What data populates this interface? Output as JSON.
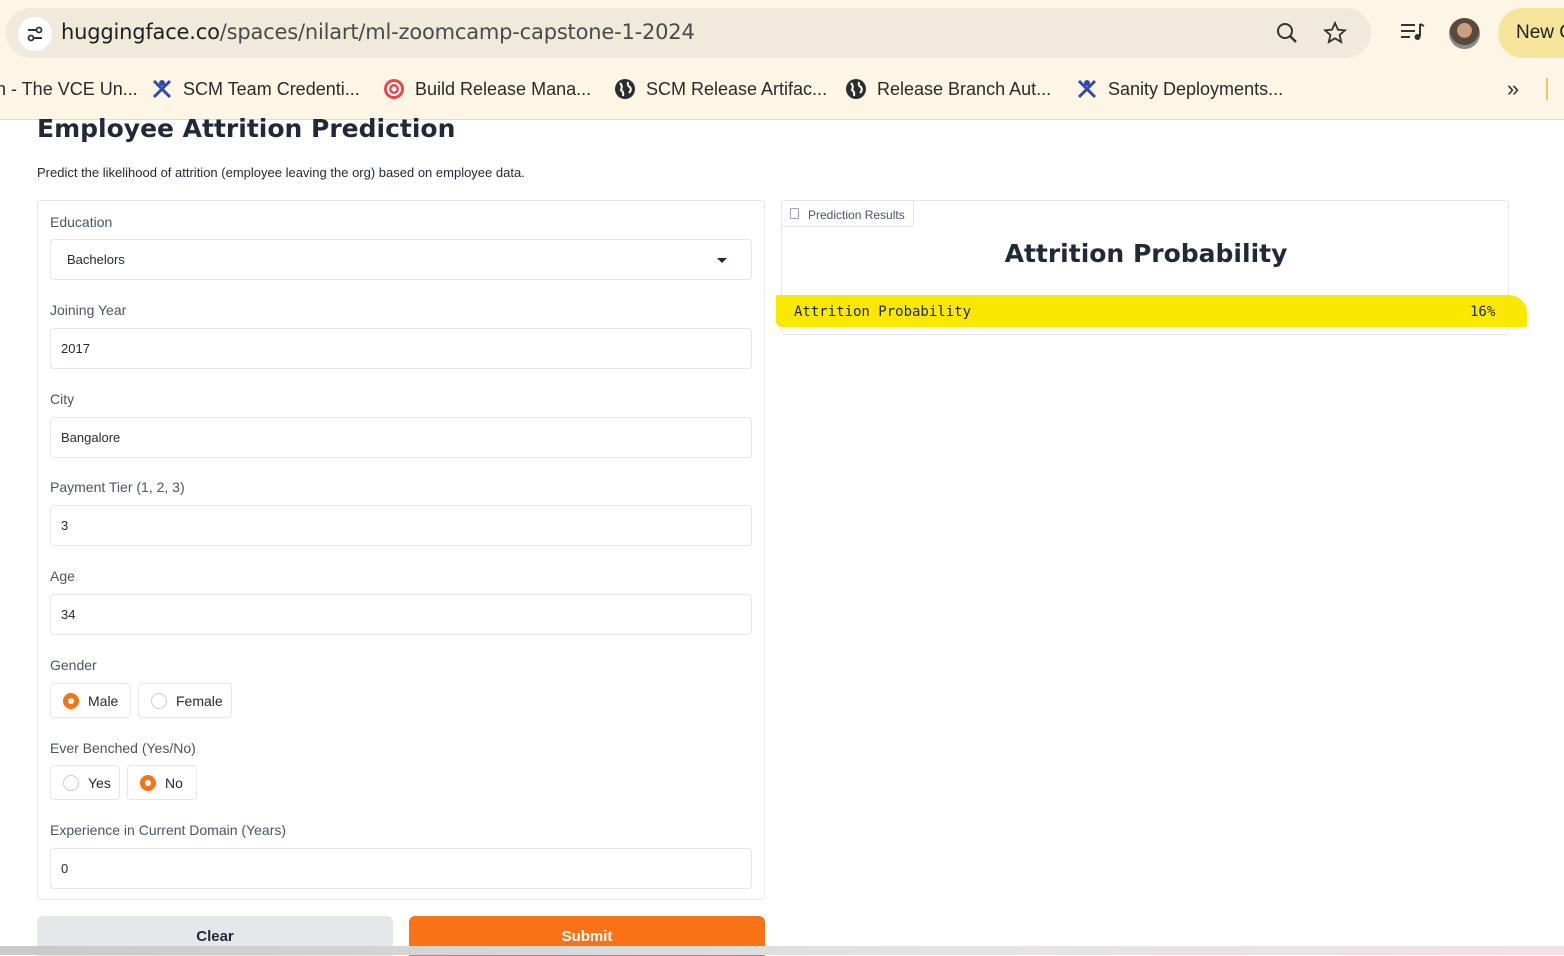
{
  "browser": {
    "url_host": "huggingface.co",
    "url_path": "/spaces/nilart/ml-zoomcamp-capstone-1-2024",
    "new_chip_label": "New C",
    "bookmarks": [
      {
        "label": "n - The VCE Un...",
        "icon": "none"
      },
      {
        "label": "SCM Team Credenti...",
        "icon": "team-icon"
      },
      {
        "label": "Build Release Mana...",
        "icon": "build-icon"
      },
      {
        "label": "SCM Release Artifac...",
        "icon": "globe-icon"
      },
      {
        "label": "Release Branch Aut...",
        "icon": "globe-icon"
      },
      {
        "label": "Sanity Deployments...",
        "icon": "team-icon"
      }
    ],
    "more_label": "»"
  },
  "page": {
    "title": "Employee Attrition Prediction",
    "description": "Predict the likelihood of attrition (employee leaving the org) based on employee data."
  },
  "form": {
    "education": {
      "label": "Education",
      "value": "Bachelors"
    },
    "joining_year": {
      "label": "Joining Year",
      "value": "2017"
    },
    "city": {
      "label": "City",
      "value": "Bangalore"
    },
    "payment_tier": {
      "label": "Payment Tier (1, 2, 3)",
      "value": "3"
    },
    "age": {
      "label": "Age",
      "value": "34"
    },
    "gender": {
      "label": "Gender",
      "options": [
        "Male",
        "Female"
      ],
      "selected": "Male"
    },
    "ever_benched": {
      "label": "Ever Benched (Yes/No)",
      "options": [
        "Yes",
        "No"
      ],
      "selected": "No"
    },
    "experience": {
      "label": "Experience in Current Domain (Years)",
      "value": "0"
    }
  },
  "buttons": {
    "clear": "Clear",
    "submit": "Submit"
  },
  "results": {
    "tab_label": "Prediction Results",
    "heading": "Attrition Probability",
    "row_label": "Attrition Probability",
    "row_value": "16%",
    "probability_fraction": 0.16
  },
  "colors": {
    "accent": "#f97316",
    "highlight": "#fbe800"
  }
}
